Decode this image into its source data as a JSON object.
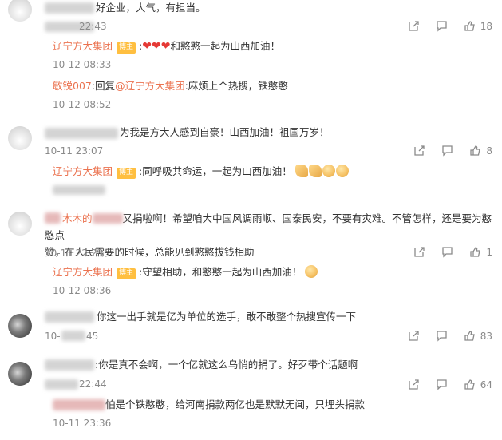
{
  "comments": [
    {
      "text": "好企业，大气，有担当。",
      "time": "22:43",
      "likes": "18",
      "replies": [
        {
          "name": "辽宁方大集团",
          "badge": "博主",
          "text": ":",
          "text_after": "和憨憨一起为山西加油！",
          "time": "10-12 08:33"
        },
        {
          "name": "敏锐007",
          "text_prefix": ":回复",
          "mention": "@辽宁方大集团",
          "text": ":麻烦上个热搜，铁憨憨",
          "time": "10-12 08:52"
        }
      ]
    },
    {
      "text": "为我是方大人感到自豪！山西加油！祖国万岁！",
      "time": "10-11 23:07",
      "likes": "8",
      "replies": [
        {
          "name": "辽宁方大集团",
          "badge": "博主",
          "text": ":同呼吸共命运，一起为山西加油！"
        }
      ]
    },
    {
      "name_visible": "木木的",
      "text_line1": "又捐啦啊！希望咱大中国风调雨顺、国泰民安，不要有灾难。不管怎样，还是要为憨憨点",
      "text_line2": "赞，在人民需要的时候，总能见到憨憨拔钱相助",
      "time": "10-11 22:23",
      "likes": "1",
      "replies": [
        {
          "name": "辽宁方大集团",
          "badge": "博主",
          "text": ":守望相助，和憨憨一起为山西加油！",
          "time": "10-12 08:36"
        }
      ]
    },
    {
      "text": "你这一出手就是亿为单位的选手，敢不敢整个热搜宣传一下",
      "time_prefix": "10-",
      "time_suffix": "45",
      "likes": "83"
    },
    {
      "text": ":你是真不会啊，一个亿就这么乌悄的捐了。好歹带个话题啊",
      "time": "22:44",
      "likes": "64",
      "replies": [
        {
          "text": "怕是个铁憨憨，给河南捐款两亿也是默默无闻，只埋头捐款",
          "time": "10-11 23:36"
        }
      ]
    }
  ]
}
